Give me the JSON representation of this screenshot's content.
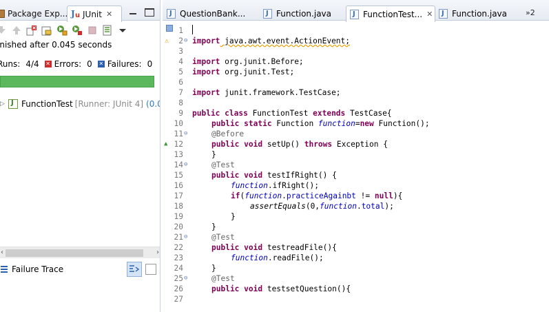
{
  "left_panel": {
    "tabs": [
      {
        "label": "Package Exp..."
      },
      {
        "label": "JUnit"
      }
    ],
    "status": "inished after 0.045 seconds",
    "runs_label": "Runs:",
    "runs_value": "4/4",
    "errors_label": "Errors:",
    "errors_value": "0",
    "failures_label": "Failures:",
    "failures_value": "0",
    "progress": 1.0,
    "progress_color": "#5cb85c",
    "tree": {
      "name": "FunctionTest",
      "runner": "[Runner: JUnit 4]",
      "time": "(0.0"
    },
    "failure_trace_title": "Failure Trace"
  },
  "editor": {
    "tabs": [
      {
        "label": "QuestionBank..."
      },
      {
        "label": "Function.java"
      },
      {
        "label": "FunctionTest..."
      },
      {
        "label": "Function.java"
      }
    ],
    "overflow_label": "»2",
    "lines": [
      "1",
      "2",
      "3",
      "4",
      "5",
      "6",
      "7",
      "8",
      "9",
      "10",
      "11",
      "12",
      "13",
      "14",
      "15",
      "16",
      "17",
      "18",
      "19",
      "20",
      "21",
      "22",
      "23",
      "24",
      "25",
      "26",
      "27"
    ],
    "code": {
      "l2_kw": "import",
      "l2_rest": " java.awt.event.ActionEvent;",
      "l4_kw": "import",
      "l4_rest": " org.junit.Before;",
      "l5_kw": "import",
      "l5_rest": " org.junit.Test;",
      "l7_kw": "import",
      "l7_rest": " junit.framework.TestCase;",
      "l9_kw1": "public class",
      "l9_a": " FunctionTest ",
      "l9_kw2": "extends",
      "l9_b": " TestCase{",
      "l10_kw": "public static",
      "l10_a": " Function ",
      "l10_f": "function",
      "l10_b": "=",
      "l10_kw2": "new",
      "l10_c": " Function();",
      "l11_ann": "@Before",
      "l12_kw": "public void",
      "l12_a": " setUp() ",
      "l12_kw2": "throws",
      "l12_b": " Exception {",
      "l13": "}",
      "l14_ann": "@Test",
      "l15_kw": "public void",
      "l15_a": " testIfRight() {",
      "l16_f": "function",
      "l16_a": ".ifRight();",
      "l17_kw": "if",
      "l17_a": "(",
      "l17_f": "function",
      "l17_b": ".",
      "l17_g": "practiceAgainbt",
      "l17_c": " != ",
      "l17_kw2": "null",
      "l17_d": "){",
      "l18_m": "assertEquals",
      "l18_a": "(0,",
      "l18_f": "function",
      "l18_b": ".",
      "l18_g": "total",
      "l18_c": ");",
      "l19": "}",
      "l20": "}",
      "l21_ann": "@Test",
      "l22_kw": "public void",
      "l22_a": " testreadFile(){",
      "l23_f": "function",
      "l23_a": ".readFile();",
      "l24": "}",
      "l25_ann": "@Test",
      "l26_kw": "public void",
      "l26_a": " testsetQuestion(){"
    }
  }
}
